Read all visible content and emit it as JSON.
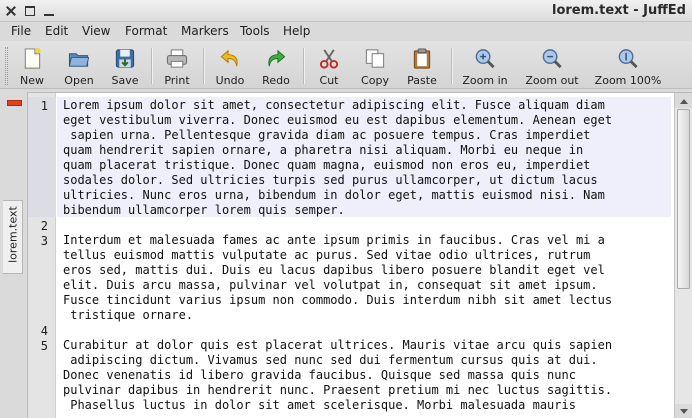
{
  "window": {
    "title": "lorem.text - JuffEd"
  },
  "menu": [
    "File",
    "Edit",
    "View",
    "Format",
    "Markers",
    "Tools",
    "Help"
  ],
  "toolbar": {
    "new": "New",
    "open": "Open",
    "save": "Save",
    "print": "Print",
    "undo": "Undo",
    "redo": "Redo",
    "cut": "Cut",
    "copy": "Copy",
    "paste": "Paste",
    "zoom_in": "Zoom in",
    "zoom_out": "Zoom out",
    "zoom_100": "Zoom 100%"
  },
  "tab": {
    "label": "lorem.text"
  },
  "editor": {
    "current_line": 1,
    "lines": [
      {
        "num": "1",
        "rows": [
          "Lorem ipsum dolor sit amet, consectetur adipiscing elit. Fusce aliquam diam",
          "eget vestibulum viverra. Donec euismod eu est dapibus elementum. Aenean eget",
          " sapien urna. Pellentesque gravida diam ac posuere tempus. Cras imperdiet",
          "quam hendrerit sapien ornare, a pharetra nisi aliquam. Morbi eu neque in",
          "quam placerat tristique. Donec quam magna, euismod non eros eu, imperdiet",
          "sodales dolor. Sed ultricies turpis sed purus ullamcorper, ut dictum lacus",
          "ultricies. Nunc eros urna, bibendum in dolor eget, mattis euismod nisi. Nam",
          "bibendum ullamcorper lorem quis semper."
        ]
      },
      {
        "num": "2",
        "rows": [
          ""
        ]
      },
      {
        "num": "3",
        "rows": [
          "Interdum et malesuada fames ac ante ipsum primis in faucibus. Cras vel mi a",
          "tellus euismod mattis vulputate ac purus. Sed vitae odio ultrices, rutrum",
          "eros sed, mattis dui. Duis eu lacus dapibus libero posuere blandit eget vel",
          "elit. Duis arcu massa, pulvinar vel volutpat in, consequat sit amet ipsum.",
          "Fusce tincidunt varius ipsum non commodo. Duis interdum nibh sit amet lectus",
          " tristique ornare."
        ]
      },
      {
        "num": "4",
        "rows": [
          ""
        ]
      },
      {
        "num": "5",
        "rows": [
          "Curabitur at dolor quis est placerat ultrices. Mauris vitae arcu quis sapien",
          " adipiscing dictum. Vivamus sed nunc sed dui fermentum cursus quis at dui.",
          "Donec venenatis id libero gravida faucibus. Quisque sed massa quis nunc",
          "pulvinar dapibus in hendrerit nunc. Praesent pretium mi nec luctus sagittis.",
          " Phasellus luctus in dolor sit amet scelerisque. Morbi malesuada mauris"
        ]
      }
    ]
  }
}
